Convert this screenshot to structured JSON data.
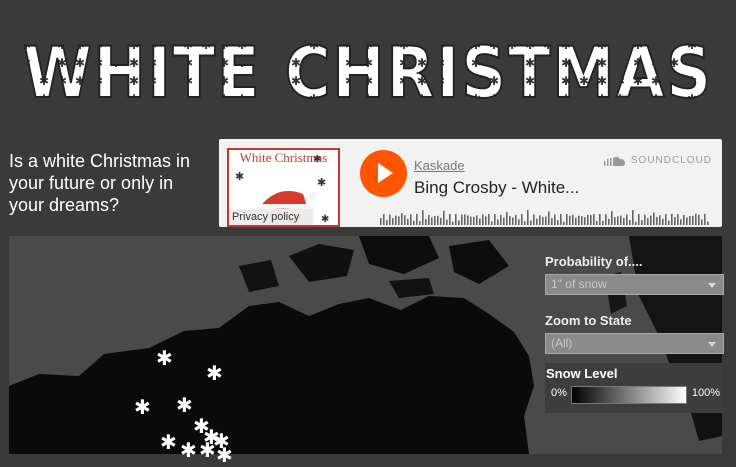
{
  "banner": {
    "title": "WHITE CHRISTMAS"
  },
  "intro": {
    "text": "Is a white Christmas in your future or only in your dreams?"
  },
  "player": {
    "artwork_text": "White Christmas",
    "privacy_label": "Privacy policy",
    "artist": "Kaskade",
    "track": "Bing Crosby - White...",
    "brand": "SOUNDCLOUD",
    "play_icon": "play-icon",
    "accent_color": "#ff5500"
  },
  "filters": {
    "probability": {
      "label": "Probability of....",
      "value": "1\" of snow"
    },
    "state": {
      "label": "Zoom to State",
      "value": "(All)"
    }
  },
  "legend": {
    "title": "Snow Level",
    "min": "0%",
    "max": "100%"
  },
  "map": {
    "marker_glyph": "✱",
    "marker_count": 11
  }
}
